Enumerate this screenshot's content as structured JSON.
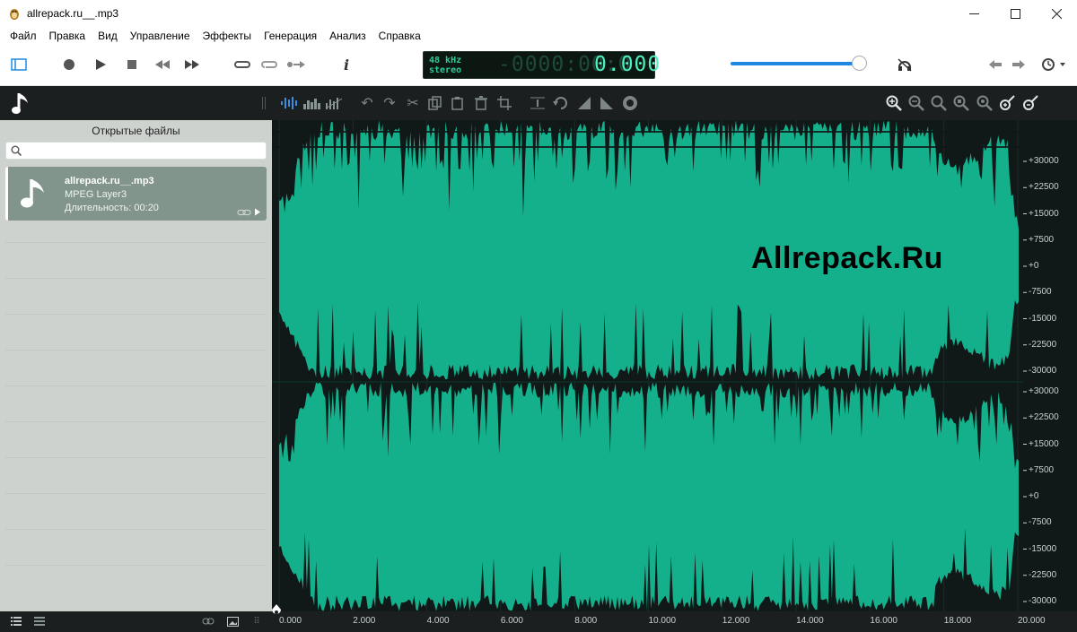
{
  "window": {
    "title": "allrepack.ru__.mp3"
  },
  "menu": [
    "Файл",
    "Правка",
    "Вид",
    "Управление",
    "Эффекты",
    "Генерация",
    "Анализ",
    "Справка"
  ],
  "display": {
    "rate": "48 kHz",
    "channels": "stereo",
    "time_dim": "-0000:00:0",
    "time_value": "0.000"
  },
  "volume": {
    "level": 0.95
  },
  "left_panel": {
    "title": "Открытые файлы",
    "search_placeholder": "",
    "file": {
      "name": "allrepack.ru__.mp3",
      "format": "MPEG Layer3",
      "duration": "Длительность: 00:20"
    }
  },
  "waveform": {
    "color": "#14b08c",
    "watermark": "Allrepack.Ru",
    "amp_labels_ch1": [
      "+30000",
      "+22500",
      "+15000",
      "+7500",
      "+0",
      "-7500",
      "-15000",
      "-22500",
      "-30000"
    ],
    "amp_labels_ch2": [
      "+30000",
      "+22500",
      "+15000",
      "+7500",
      "+0",
      "-7500",
      "-15000",
      "-22500",
      "-30000"
    ]
  },
  "timeline": {
    "labels": [
      "0.000",
      "2.000",
      "4.000",
      "6.000",
      "8.000",
      "10.000",
      "12.000",
      "14.000",
      "16.000",
      "18.000",
      "20.000"
    ]
  },
  "icons": {
    "transport": [
      "panel-toggle-icon",
      "record-icon",
      "play-icon",
      "stop-icon",
      "rewind-icon",
      "fast-forward-icon",
      "loop-icon",
      "loop-selection-icon",
      "skip-silence-icon",
      "info-icon"
    ],
    "right": [
      "headphones-mute-icon",
      "arrow-left-icon",
      "arrow-right-icon",
      "history-icon"
    ]
  }
}
